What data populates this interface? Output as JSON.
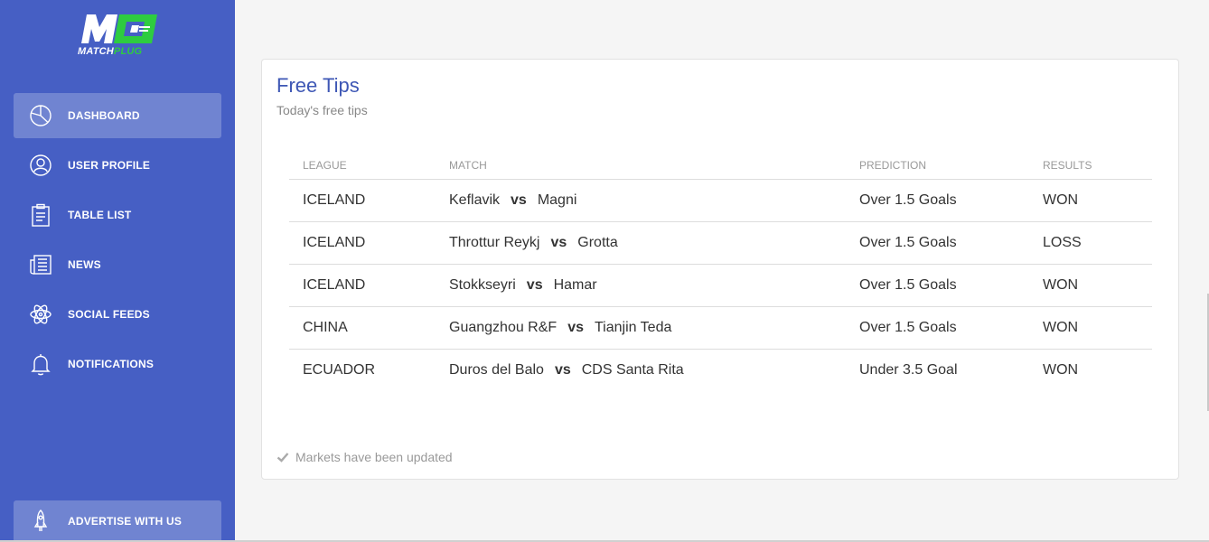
{
  "brand": {
    "logo_prefix": "MATCH",
    "logo_suffix": "PLUG"
  },
  "sidebar": {
    "items": [
      {
        "label": "DASHBOARD",
        "icon": "pie-chart-icon",
        "active": true
      },
      {
        "label": "USER PROFILE",
        "icon": "user-icon"
      },
      {
        "label": "TABLE LIST",
        "icon": "clipboard-icon"
      },
      {
        "label": "NEWS",
        "icon": "newspaper-icon"
      },
      {
        "label": "SOCIAL FEEDS",
        "icon": "atom-icon"
      },
      {
        "label": "NOTIFICATIONS",
        "icon": "bell-icon"
      }
    ],
    "advertise": {
      "label": "ADVERTISE WITH US",
      "icon": "rocket-icon"
    }
  },
  "card": {
    "title": "Free Tips",
    "subtitle": "Today's free tips",
    "columns": [
      "LEAGUE",
      "MATCH",
      "PREDICTION",
      "RESULTS"
    ],
    "rows": [
      {
        "league": "ICELAND",
        "home": "Keflavik",
        "vs": "vs",
        "away": "Magni",
        "prediction": "Over 1.5 Goals",
        "result": "WON"
      },
      {
        "league": "ICELAND",
        "home": "Throttur Reykj",
        "vs": "vs",
        "away": "Grotta",
        "prediction": "Over 1.5 Goals",
        "result": "LOSS"
      },
      {
        "league": "ICELAND",
        "home": "Stokkseyri",
        "vs": "vs",
        "away": "Hamar",
        "prediction": "Over 1.5 Goals",
        "result": "WON"
      },
      {
        "league": "CHINA",
        "home": "Guangzhou R&F",
        "vs": "vs",
        "away": "Tianjin Teda",
        "prediction": "Over 1.5 Goals",
        "result": "WON"
      },
      {
        "league": "ECUADOR",
        "home": "Duros del Balo",
        "vs": "vs",
        "away": "CDS Santa Rita",
        "prediction": "Under 3.5 Goal",
        "result": "WON"
      }
    ],
    "footer": {
      "icon": "check-icon",
      "text": "Markets have been updated"
    }
  },
  "colors": {
    "sidebar": "#465fc4",
    "accent": "#3e57b5",
    "logo_green": "#2ecc40"
  }
}
